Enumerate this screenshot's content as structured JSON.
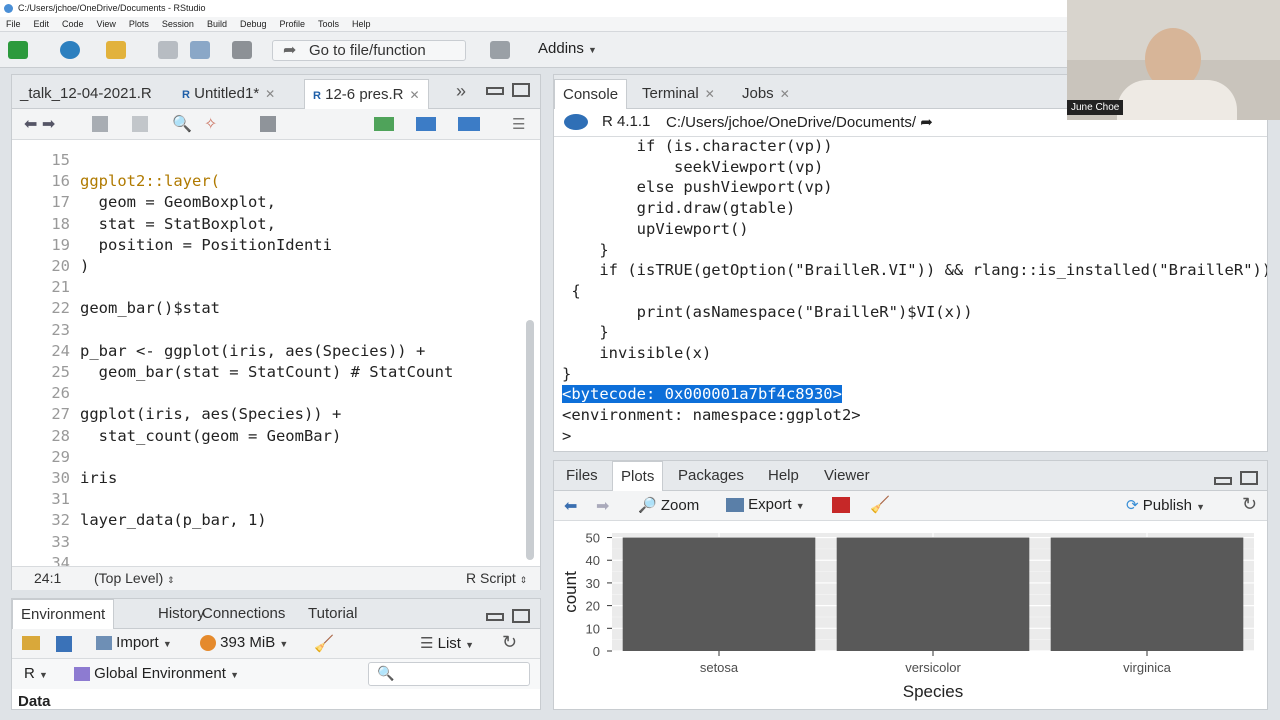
{
  "window": {
    "title": "C:/Users/jchoe/OneDrive/Documents - RStudio"
  },
  "menu": [
    "File",
    "Edit",
    "Code",
    "View",
    "Plots",
    "Session",
    "Build",
    "Debug",
    "Profile",
    "Tools",
    "Help"
  ],
  "toolbar": {
    "goto_label": "Go to file/function",
    "addins_label": "Addins"
  },
  "editor": {
    "tabs": [
      {
        "label": "_talk_12-04-2021.R"
      },
      {
        "label": "Untitled1*"
      },
      {
        "label": "12-6 pres.R"
      }
    ],
    "lines": [
      {
        "n": "15",
        "t": ""
      },
      {
        "n": "16",
        "t": "ggplot2::layer("
      },
      {
        "n": "17",
        "t": "  geom = GeomBoxplot,"
      },
      {
        "n": "18",
        "t": "  stat = StatBoxplot,"
      },
      {
        "n": "19",
        "t": "  position = PositionIdenti"
      },
      {
        "n": "20",
        "t": ")"
      },
      {
        "n": "21",
        "t": ""
      },
      {
        "n": "22",
        "t": "geom_bar()$stat"
      },
      {
        "n": "23",
        "t": ""
      },
      {
        "n": "24",
        "t": "p_bar <- ggplot(iris, aes(Species)) +"
      },
      {
        "n": "25",
        "t": "  geom_bar(stat = StatCount) # StatCount"
      },
      {
        "n": "26",
        "t": ""
      },
      {
        "n": "27",
        "t": "ggplot(iris, aes(Species)) +"
      },
      {
        "n": "28",
        "t": "  stat_count(geom = GeomBar)"
      },
      {
        "n": "29",
        "t": ""
      },
      {
        "n": "30",
        "t": "iris"
      },
      {
        "n": "31",
        "t": ""
      },
      {
        "n": "32",
        "t": "layer_data(p_bar, 1)"
      },
      {
        "n": "33",
        "t": ""
      },
      {
        "n": "34",
        "t": ""
      }
    ],
    "status": {
      "position": "24:1",
      "scope": "(Top Level)",
      "filetype": "R Script"
    }
  },
  "console": {
    "tabs": [
      {
        "label": "Console"
      },
      {
        "label": "Terminal"
      },
      {
        "label": "Jobs"
      }
    ],
    "r_version": "R 4.1.1",
    "wd": "C:/Users/jchoe/OneDrive/Documents/",
    "lines": [
      "        if (is.character(vp))",
      "            seekViewport(vp)",
      "        else pushViewport(vp)",
      "        grid.draw(gtable)",
      "        upViewport()",
      "    }",
      "    if (isTRUE(getOption(\"BrailleR.VI\")) && rlang::is_installed(\"BrailleR\"))",
      " {",
      "        print(asNamespace(\"BrailleR\")$VI(x))",
      "    }",
      "    invisible(x)",
      "}",
      "<bytecode: 0x000001a7bf4c8930>",
      "<environment: namespace:ggplot2>",
      "> "
    ]
  },
  "environment": {
    "tabs": [
      {
        "label": "Environment"
      },
      {
        "label": "History"
      },
      {
        "label": "Connections"
      },
      {
        "label": "Tutorial"
      }
    ],
    "import_label": "Import",
    "memory": "393 MiB",
    "view_label": "List",
    "lang": "R",
    "scope": "Global Environment",
    "data_label": "Data"
  },
  "files": {
    "tabs": [
      {
        "label": "Files"
      },
      {
        "label": "Plots"
      },
      {
        "label": "Packages"
      },
      {
        "label": "Help"
      },
      {
        "label": "Viewer"
      }
    ],
    "zoom_label": "Zoom",
    "export_label": "Export",
    "publish_label": "Publish"
  },
  "chart_data": {
    "type": "bar",
    "categories": [
      "setosa",
      "versicolor",
      "virginica"
    ],
    "values": [
      50,
      50,
      50
    ],
    "xlabel": "Species",
    "ylabel": "count",
    "ylim": [
      0,
      52
    ],
    "yticks": [
      "0",
      "10",
      "20",
      "30",
      "40",
      "50"
    ],
    "grid": true
  },
  "webcam": {
    "name": "June Choe"
  }
}
